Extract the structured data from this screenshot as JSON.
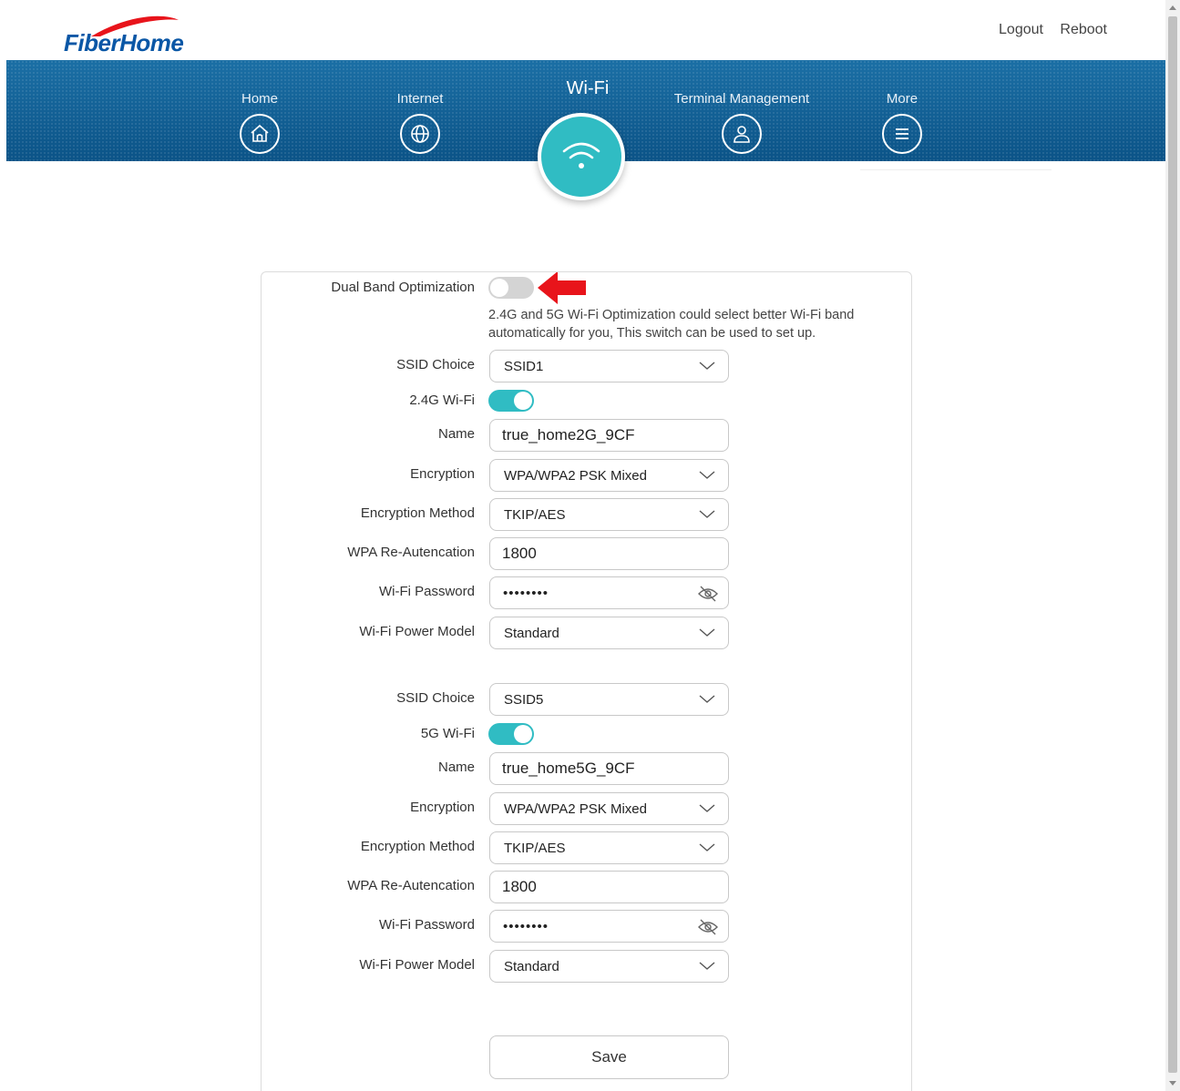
{
  "header": {
    "brand": "FiberHome",
    "logout_label": "Logout",
    "reboot_label": "Reboot"
  },
  "nav": {
    "home": "Home",
    "internet": "Internet",
    "wifi": "Wi-Fi",
    "terminal": "Terminal Management",
    "more": "More"
  },
  "dual_band": {
    "label": "Dual Band Optimization",
    "enabled": false,
    "description": "2.4G and 5G Wi-Fi Optimization could select better Wi-Fi band automatically for you, This switch can be used to set up."
  },
  "band_24": {
    "ssid_label": "SSID Choice",
    "ssid_value": "SSID1",
    "wifi_label": "2.4G Wi-Fi",
    "wifi_enabled": true,
    "name_label": "Name",
    "name_value": "true_home2G_9CF",
    "encryption_label": "Encryption",
    "encryption_value": "WPA/WPA2 PSK Mixed",
    "method_label": "Encryption Method",
    "method_value": "TKIP/AES",
    "reauth_label": "WPA Re-Autencation",
    "reauth_value": "1800",
    "password_label": "Wi-Fi Password",
    "password_value": "••••••••",
    "power_label": "Wi-Fi Power Model",
    "power_value": "Standard"
  },
  "band_5": {
    "ssid_label": "SSID Choice",
    "ssid_value": "SSID5",
    "wifi_label": "5G Wi-Fi",
    "wifi_enabled": true,
    "name_label": "Name",
    "name_value": "true_home5G_9CF",
    "encryption_label": "Encryption",
    "encryption_value": "WPA/WPA2 PSK Mixed",
    "method_label": "Encryption Method",
    "method_value": "TKIP/AES",
    "reauth_label": "WPA Re-Autencation",
    "reauth_value": "1800",
    "password_label": "Wi-Fi Password",
    "password_value": "••••••••",
    "power_label": "Wi-Fi Power Model",
    "power_value": "Standard"
  },
  "save_label": "Save",
  "colors": {
    "accent": "#30bcc3",
    "navbar": "#0e5d93",
    "brand": "#0a57a6",
    "arrow": "#e8141b"
  }
}
